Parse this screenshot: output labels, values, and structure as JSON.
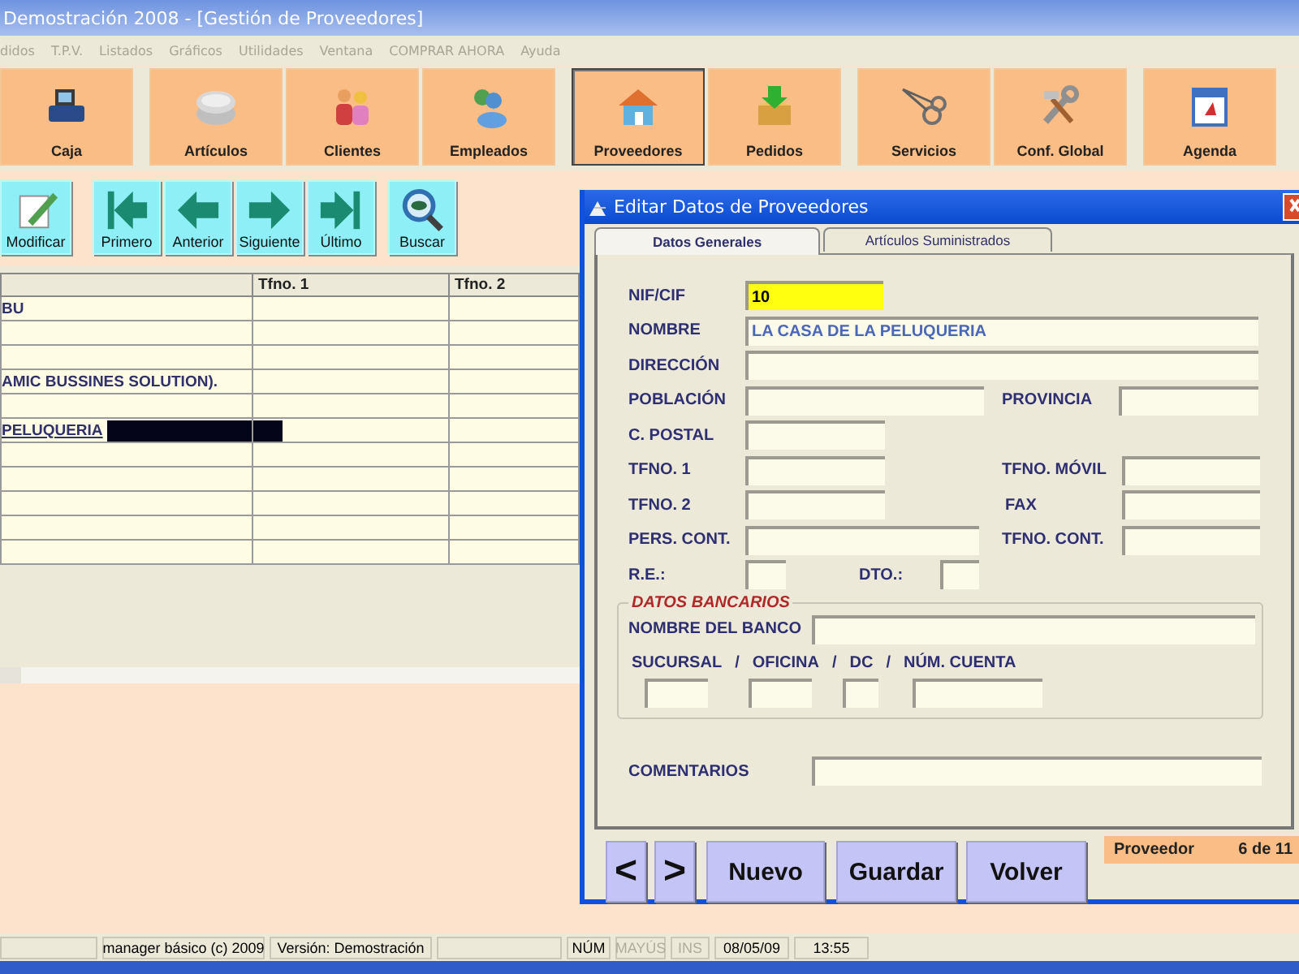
{
  "window": {
    "title": "Demostración 2008 - [Gestión de Proveedores]"
  },
  "menu": [
    {
      "label": "didos",
      "disabled": true
    },
    {
      "label": "T.P.V.",
      "disabled": true
    },
    {
      "label": "Listados",
      "disabled": true
    },
    {
      "label": "Gráficos",
      "disabled": true
    },
    {
      "label": "Utilidades",
      "disabled": true
    },
    {
      "label": "Ventana",
      "disabled": true
    },
    {
      "label": "COMPRAR AHORA",
      "disabled": true
    },
    {
      "label": "Ayuda",
      "disabled": true
    }
  ],
  "modules": [
    {
      "label": "Caja",
      "selected": false
    },
    {
      "label": "Artículos",
      "selected": false
    },
    {
      "label": "Clientes",
      "selected": false
    },
    {
      "label": "Empleados",
      "selected": false
    },
    {
      "label": "Proveedores",
      "selected": true
    },
    {
      "label": "Pedidos",
      "selected": false
    },
    {
      "label": "Servicios",
      "selected": false
    },
    {
      "label": "Conf. Global",
      "selected": false
    },
    {
      "label": "Agenda",
      "selected": false
    }
  ],
  "actions": [
    {
      "label": "Modificar"
    },
    {
      "label": "Primero"
    },
    {
      "label": "Anterior"
    },
    {
      "label": "Siguiente"
    },
    {
      "label": "Último"
    },
    {
      "label": "Buscar"
    }
  ],
  "table": {
    "columns": [
      "Tfno. 1",
      "Tfno. 2"
    ],
    "rows": [
      {
        "column_1": "BU",
        "selected": false
      },
      {
        "selected": false
      },
      {
        "selected": false
      },
      {
        "column_1": "AMIC BUSSINES SOLUTION).",
        "selected": false
      },
      {
        "selected": false
      },
      {
        "column_1": "PELUQUERIA",
        "selected": true
      },
      {
        "selected": false
      },
      {
        "selected": false
      },
      {
        "selected": false
      },
      {
        "selected": false
      },
      {
        "selected": false
      }
    ]
  },
  "dialog": {
    "title": "Editar Datos de Proveedores",
    "tabs": [
      {
        "label": "Datos Generales",
        "selected": true
      },
      {
        "label": "Artículos Suministrados",
        "selected": false
      }
    ],
    "rows": [
      [
        {
          "label": "NIF/CIF",
          "value": "10",
          "focused": true
        }
      ],
      [
        {
          "label": "NOMBRE",
          "value": "LA CASA DE LA PELUQUERIA",
          "focused": false
        }
      ],
      [
        {
          "label": "DIRECCIÓN",
          "focused": false
        }
      ],
      [
        {
          "label": "POBLACIÓN",
          "focused": false
        },
        {
          "label": "PROVINCIA",
          "focused": false
        }
      ],
      [
        {
          "label": "C. POSTAL",
          "focused": false
        }
      ],
      [
        {
          "label": "TFNO. 1",
          "focused": false
        },
        {
          "label": "TFNO. MÓVIL",
          "focused": false
        }
      ],
      [
        {
          "label": "TFNO. 2",
          "focused": false
        },
        {
          "label": "FAX",
          "focused": false
        }
      ],
      [
        {
          "label": "PERS. CONT.",
          "focused": false
        },
        {
          "label": "TFNO. CONT.",
          "focused": false
        }
      ],
      [
        {
          "label": "R.E.:",
          "focused": false
        },
        {
          "label": "DTO.:",
          "focused": false
        }
      ]
    ],
    "bank": {
      "title": "DATOS BANCARIOS",
      "bank_label": "NOMBRE DEL BANCO",
      "account_labels": [
        "SUCURSAL",
        "/",
        "OFICINA",
        "/",
        "DC",
        "/",
        "NÚM. CUENTA"
      ]
    },
    "comments_label": "COMENTARIOS",
    "buttons": [
      "<",
      ">",
      "Nuevo",
      "Guardar",
      "Volver"
    ],
    "record": {
      "label": "Proveedor",
      "position": "6 de 11"
    }
  },
  "status_bar": [
    {
      "kind": "empty"
    },
    {
      "kind": "text",
      "text": "manager básico (c) 2009",
      "disabled": false
    },
    {
      "kind": "text",
      "text": "Versión: Demostración",
      "disabled": false
    },
    {
      "kind": "empty"
    },
    {
      "kind": "text",
      "text": "NÚM",
      "disabled": false
    },
    {
      "kind": "text",
      "text": "MAYÚS",
      "disabled": true
    },
    {
      "kind": "text",
      "text": "INS",
      "disabled": true
    },
    {
      "kind": "text",
      "text": "08/05/09",
      "disabled": false
    },
    {
      "kind": "text",
      "text": "13:55",
      "disabled": false
    }
  ]
}
